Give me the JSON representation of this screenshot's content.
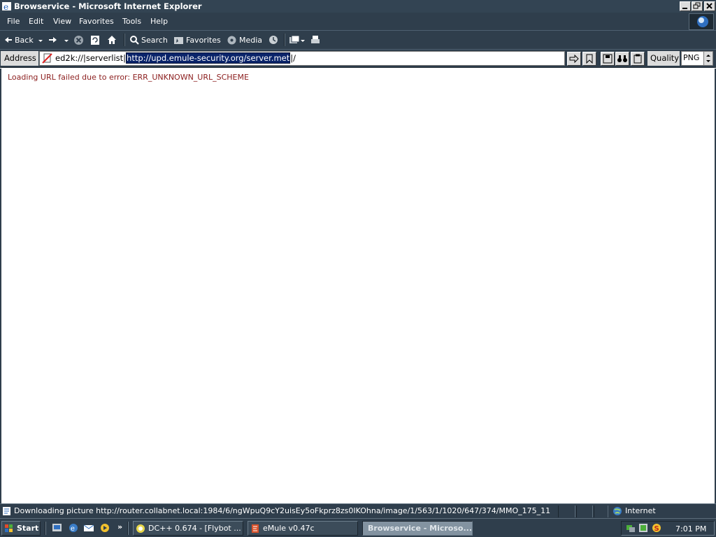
{
  "window": {
    "title": "Browservice - Microsoft Internet Explorer"
  },
  "menu": [
    "File",
    "Edit",
    "View",
    "Favorites",
    "Tools",
    "Help"
  ],
  "toolbar": {
    "back_label": "Back",
    "search_label": "Search",
    "favorites_label": "Favorites",
    "media_label": "Media"
  },
  "address": {
    "label": "Address",
    "prefix": "ed2k://|serverlist|",
    "selected": "http://upd.emule-security.org/server.met",
    "suffix": "|/"
  },
  "quality": {
    "label": "Quality",
    "value": "PNG"
  },
  "content": {
    "error": "Loading URL failed due to error: ERR_UNKNOWN_URL_SCHEME"
  },
  "status": {
    "text": "Downloading picture http://router.collabnet.local:1984/6/ngWpuQ9cY2uisEy5oFkprz8zs0IKOhna/image/1/563/1/1020/647/374/MMO_175_11",
    "zone": "Internet"
  },
  "taskbar": {
    "start_label": "Start",
    "overflow": "»",
    "tasks": [
      "DC++ 0.674 - [Flybot ...",
      "eMule v0.47c",
      "Browservice - Microso..."
    ],
    "clock": "7:01 PM"
  },
  "colors": {
    "chrome": "#2f3e4c",
    "error_text": "#8b1d1d",
    "selection": "#0a246a"
  }
}
